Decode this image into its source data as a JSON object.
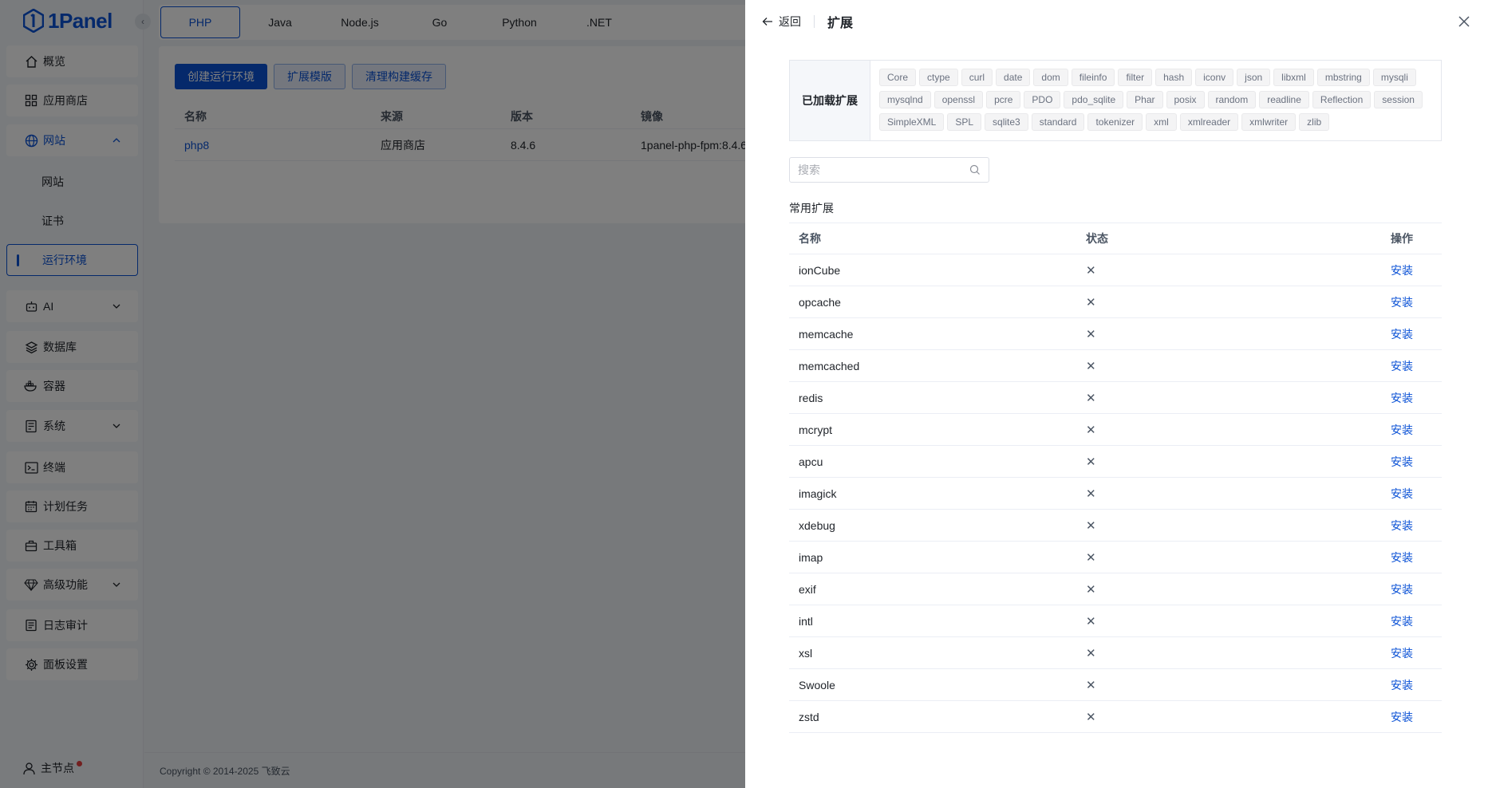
{
  "brand": {
    "name": "1Panel",
    "color": "#0b52d6"
  },
  "sidebar": {
    "items": [
      {
        "label": "概览",
        "icon": "home-icon"
      },
      {
        "label": "应用商店",
        "icon": "grid-icon"
      },
      {
        "label": "网站",
        "icon": "globe-icon"
      },
      {
        "label": "AI",
        "icon": "robot-icon"
      },
      {
        "label": "数据库",
        "icon": "layers-icon"
      },
      {
        "label": "容器",
        "icon": "docker-icon"
      },
      {
        "label": "系统",
        "icon": "server-icon"
      },
      {
        "label": "终端",
        "icon": "terminal-icon"
      },
      {
        "label": "计划任务",
        "icon": "calendar-icon"
      },
      {
        "label": "工具箱",
        "icon": "toolbox-icon"
      },
      {
        "label": "高级功能",
        "icon": "diamond-icon"
      },
      {
        "label": "日志审计",
        "icon": "log-icon"
      },
      {
        "label": "面板设置",
        "icon": "gear-icon"
      }
    ],
    "website_sub": [
      {
        "label": "网站"
      },
      {
        "label": "证书"
      },
      {
        "label": "运行环境"
      }
    ],
    "node": {
      "label": "主节点"
    }
  },
  "tabs": [
    "PHP",
    "Java",
    "Node.js",
    "Go",
    "Python",
    ".NET"
  ],
  "toolbar": {
    "create_label": "创建运行环境",
    "template_label": "扩展模版",
    "clear_label": "清理构建缓存"
  },
  "runtime_table": {
    "headers": [
      "名称",
      "来源",
      "版本",
      "镜像"
    ],
    "rows": [
      {
        "name": "php8",
        "source": "应用商店",
        "version": "8.4.6",
        "image": "1panel-php-fpm:8.4.6"
      }
    ]
  },
  "footer": {
    "copyright": "Copyright © 2014-2025 飞致云"
  },
  "drawer": {
    "back_label": "返回",
    "title": "扩展",
    "loaded_label": "已加载扩展",
    "loaded": [
      "Core",
      "ctype",
      "curl",
      "date",
      "dom",
      "fileinfo",
      "filter",
      "hash",
      "iconv",
      "json",
      "libxml",
      "mbstring",
      "mysqli",
      "mysqlnd",
      "openssl",
      "pcre",
      "PDO",
      "pdo_sqlite",
      "Phar",
      "posix",
      "random",
      "readline",
      "Reflection",
      "session",
      "SimpleXML",
      "SPL",
      "sqlite3",
      "standard",
      "tokenizer",
      "xml",
      "xmlreader",
      "xmlwriter",
      "zlib"
    ],
    "search_placeholder": "搜索",
    "section_label": "常用扩展",
    "headers": {
      "name": "名称",
      "status": "状态",
      "action": "操作"
    },
    "status_symbol": "✕",
    "action_label": "安装",
    "extensions": [
      "ionCube",
      "opcache",
      "memcache",
      "memcached",
      "redis",
      "mcrypt",
      "apcu",
      "imagick",
      "xdebug",
      "imap",
      "exif",
      "intl",
      "xsl",
      "Swoole",
      "zstd"
    ]
  }
}
